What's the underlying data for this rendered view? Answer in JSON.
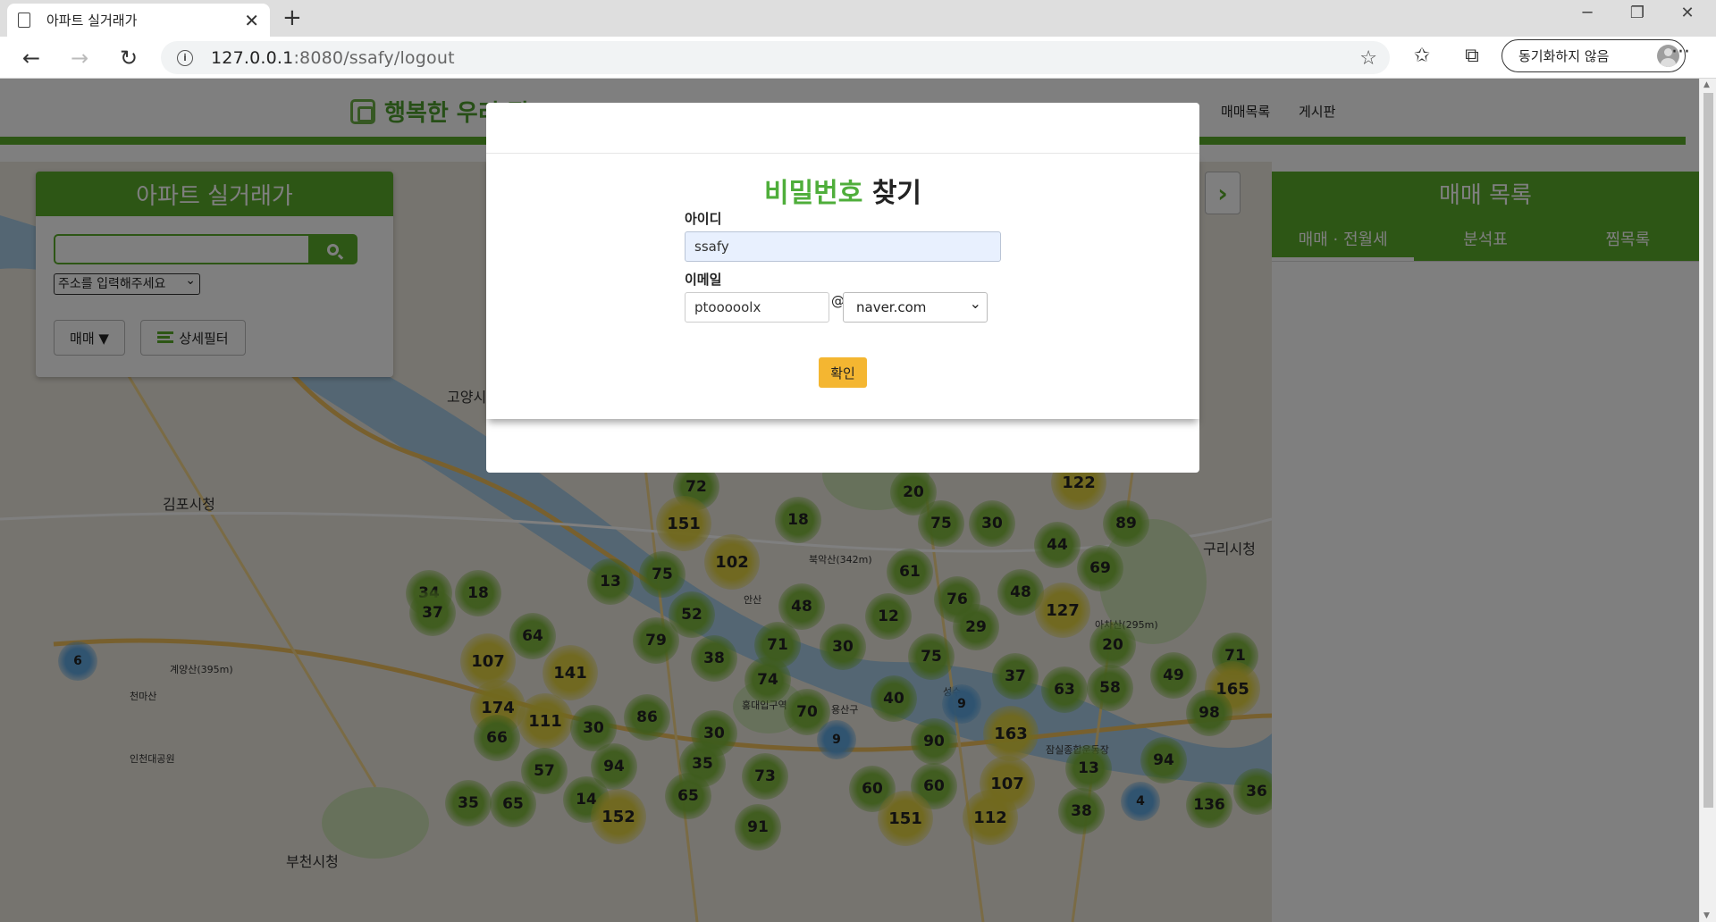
{
  "browser": {
    "tab_title": "아파트 실거래가",
    "url_host": "127.0.0.1",
    "url_rest": ":8080/ssafy/logout",
    "sync_label": "동기화하지 않음"
  },
  "header": {
    "logo_text": "행복한 우리 집",
    "menu": [
      "매매목록",
      "게시판"
    ]
  },
  "left_panel": {
    "title": "아파트 실거래가",
    "search_placeholder": "",
    "address_select": "주소를 입력해주세요",
    "deal_type_button": "매매 ▼",
    "filter_button": "상세필터"
  },
  "right_panel": {
    "title": "매매 목록",
    "tabs": [
      "매매 · 전월세",
      "분석표",
      "찜목록"
    ]
  },
  "modal": {
    "title_green": "비밀번호",
    "title_rest": " 찾기",
    "id_label": "아이디",
    "id_value": "ssafy",
    "email_label": "이메일",
    "email_local": "ptooooolx",
    "email_at": "@",
    "email_domain": "naver.com",
    "confirm_label": "확인"
  },
  "map": {
    "place_labels": [
      "고양시",
      "김포시청",
      "부천시청",
      "구리시청",
      "계양산(395m)",
      "천마산",
      "아차산(295m)",
      "안산",
      "북악산(342m)",
      "인천대공원",
      "홍대입구역",
      "용산구",
      "성수",
      "잠실종합운동장"
    ],
    "clusters": [
      "6",
      "72",
      "151",
      "18",
      "20",
      "75",
      "30",
      "122",
      "89",
      "44",
      "69",
      "102",
      "13",
      "75",
      "61",
      "34",
      "18",
      "37",
      "48",
      "76",
      "48",
      "127",
      "52",
      "12",
      "64",
      "79",
      "71",
      "30",
      "29",
      "20",
      "107",
      "141",
      "38",
      "74",
      "75",
      "37",
      "63",
      "58",
      "49",
      "71",
      "165",
      "174",
      "111",
      "86",
      "70",
      "40",
      "9",
      "98",
      "66",
      "30",
      "30",
      "9",
      "90",
      "163",
      "94",
      "57",
      "35",
      "73",
      "13",
      "94",
      "35",
      "65",
      "14",
      "65",
      "60",
      "60",
      "107",
      "4",
      "136",
      "36",
      "152",
      "91",
      "151",
      "112",
      "38"
    ]
  },
  "colors": {
    "brand_green": "#5aad2a",
    "confirm_yellow": "#f4b631",
    "title_green": "#4fae3b"
  }
}
